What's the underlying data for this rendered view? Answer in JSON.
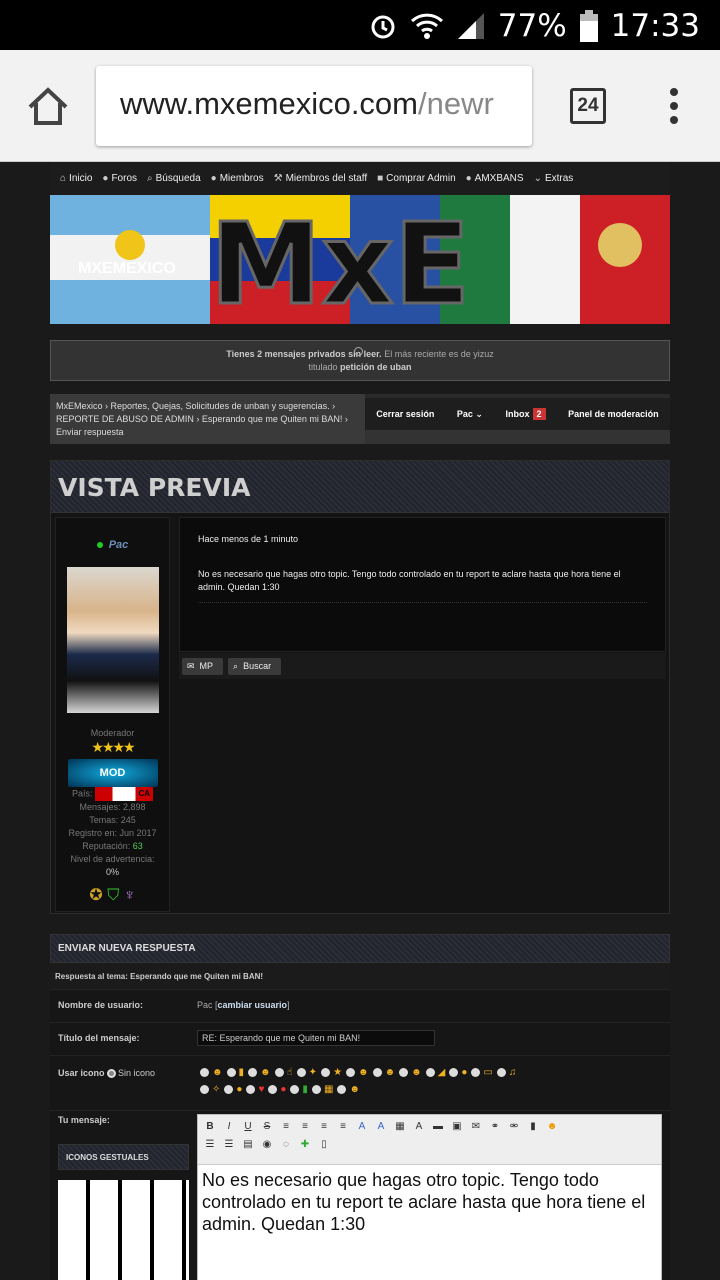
{
  "status_bar": {
    "battery": "77%",
    "time": "17:33"
  },
  "browser": {
    "url_host": "www.mxemexico.com",
    "url_path": "/newr",
    "tab_count": "24"
  },
  "nav": {
    "items": [
      "Inicio",
      "Foros",
      "Búsqueda",
      "Miembros",
      "Miembros del staff",
      "Comprar Admin",
      "AMXBANS",
      "Extras"
    ]
  },
  "banner": {
    "logo": "MXEMEXICO",
    "big_text": "MxE"
  },
  "notice": {
    "part1": "Tienes 2 mensajes privados sin leer.",
    "part2": "El más reciente es de yizuz",
    "part3": "titulado",
    "topic": "petición de uban"
  },
  "breadcrumb": {
    "line1": "MxEMexico  ›  Reportes, Quejas, Solicitudes de unban y sugerencias.  ›",
    "line2": "REPORTE DE ABUSO DE ADMIN  ›  Esperando que me Quiten mi BAN!  ›",
    "line3": "Enviar respuesta"
  },
  "user_bar": {
    "logout": "Cerrar sesión",
    "user": "Pac",
    "inbox": "Inbox",
    "inbox_count": "2",
    "modpanel": "Panel de moderación"
  },
  "preview": {
    "title": "VISTA PREVIA",
    "username": "Pac",
    "rank": "Moderador",
    "stars": "★★★★",
    "mod_badge": "MOD",
    "country_label": "País:",
    "country_code": "CA",
    "posts": "Mensajes: 2,898",
    "topics": "Temas: 245",
    "joined": "Registro en: Jun 2017",
    "rep_label": "Reputación:",
    "rep_value": "63",
    "warn_label": "Nivel de advertencia:",
    "warn_value": "0%",
    "date": "Hace menos de 1 minuto",
    "message": "No es necesario que hagas otro topic. Tengo todo controlado en tu report te aclare hasta que hora tiene el admin. Quedan 1:30",
    "btn_mp": "MP",
    "btn_search": "Buscar"
  },
  "reply": {
    "title": "ENVIAR NUEVA RESPUESTA",
    "subtitle": "Respuesta al tema: Esperando que me Quiten mi BAN!",
    "username_label": "Nombre de usuario:",
    "username_value": "Pac",
    "change_user": "cambiar usuario",
    "subject_label": "Título del mensaje:",
    "subject_value": "RE: Esperando que me Quiten mi BAN!",
    "icon_label": "Usar icono",
    "no_icon": "Sin icono",
    "message_label": "Tu mensaje:",
    "gestures_title": "ICONOS GESTUALES",
    "editor_text": "No es necesario que hagas otro topic. Tengo todo controlado en tu report te aclare hasta que hora tiene el admin. Quedan 1:30"
  }
}
